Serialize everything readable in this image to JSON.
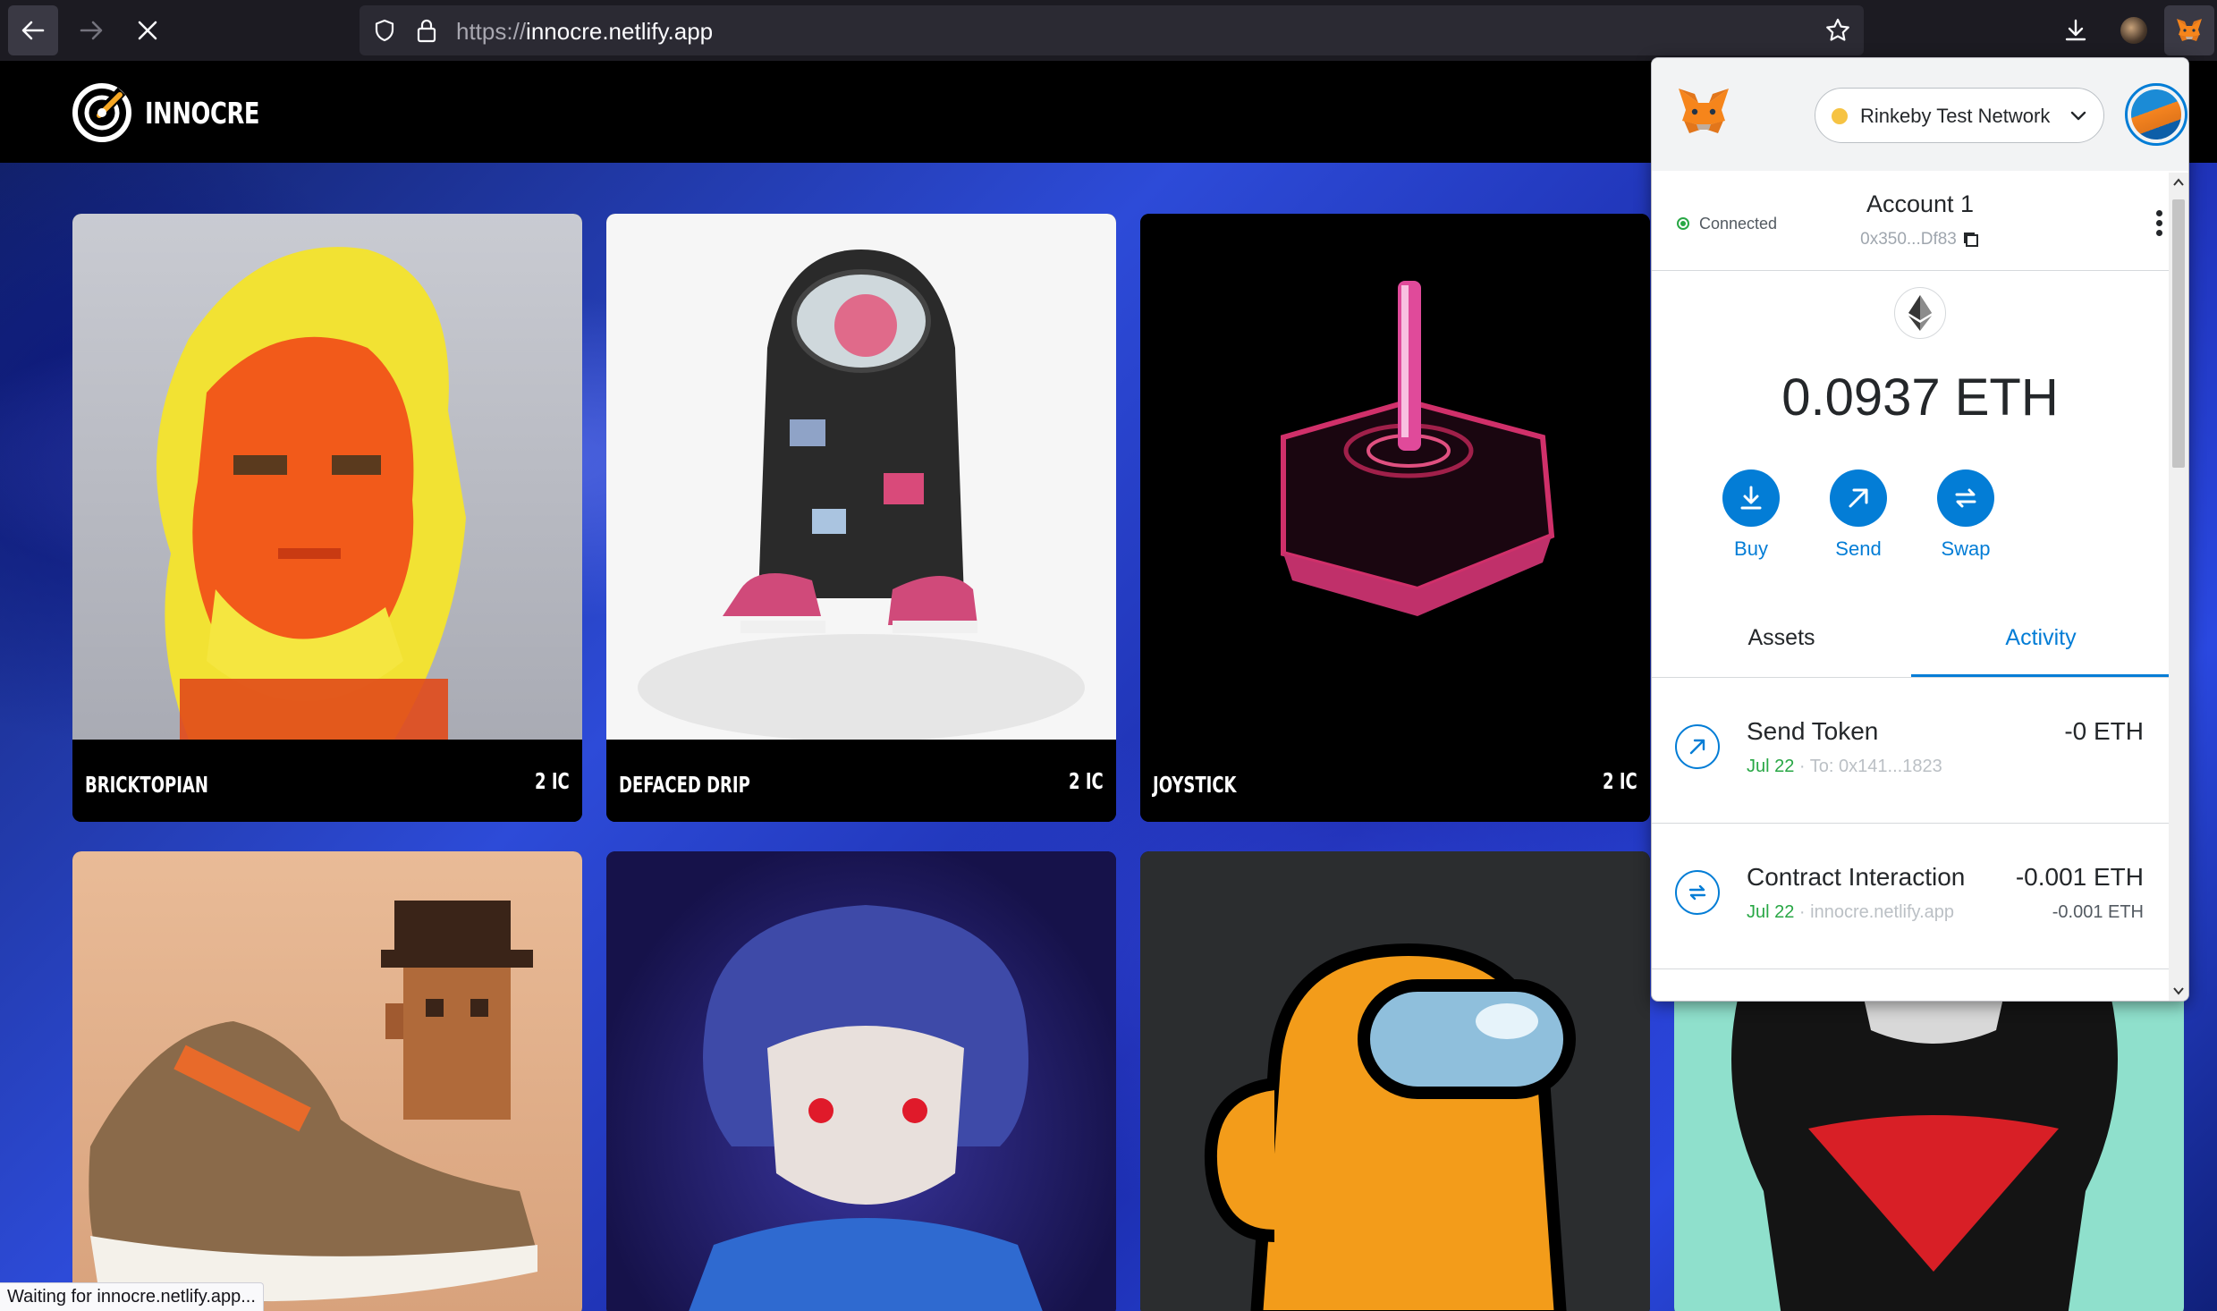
{
  "browser": {
    "url_scheme": "https://",
    "url_host": "innocre.netlify.app",
    "status_text": "Waiting for innocre.netlify.app..."
  },
  "site": {
    "brand": "INNOCRE",
    "cards": [
      {
        "title": "BRICKTOPIAN",
        "price": "2 IC"
      },
      {
        "title": "DEFACED DRIP",
        "price": "2 IC"
      },
      {
        "title": "JOYSTICK",
        "price": "2 IC"
      }
    ]
  },
  "metamask": {
    "network": "Rinkeby Test Network",
    "connection_status": "Connected",
    "account_name": "Account 1",
    "account_address": "0x350...Df83",
    "balance": "0.0937 ETH",
    "actions": {
      "buy": "Buy",
      "send": "Send",
      "swap": "Swap"
    },
    "tabs": {
      "assets": "Assets",
      "activity": "Activity"
    },
    "transactions": [
      {
        "name": "Send Token",
        "amount": "-0 ETH",
        "date": "Jul 22",
        "detail": "To: 0x141...1823",
        "secondary_amount": ""
      },
      {
        "name": "Contract Interaction",
        "amount": "-0.001 ETH",
        "date": "Jul 22",
        "detail": "innocre.netlify.app",
        "secondary_amount": "-0.001 ETH"
      }
    ]
  },
  "colors": {
    "metamask_accent": "#037dd6",
    "network_dot": "#f6c343",
    "connected": "#28a745",
    "page_background": "#2d4bd8"
  }
}
